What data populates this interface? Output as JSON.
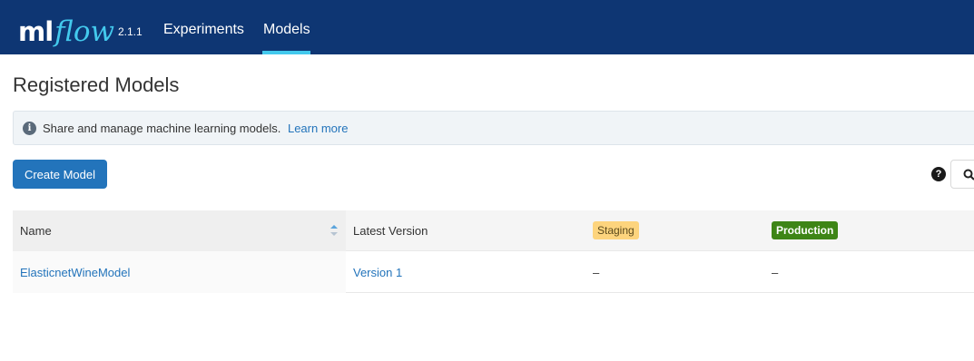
{
  "header": {
    "logo_ml": "ml",
    "logo_flow": "flow",
    "version": "2.1.1",
    "nav": [
      {
        "label": "Experiments"
      },
      {
        "label": "Models"
      }
    ],
    "active_tab": "Models",
    "colors": {
      "bar": "#0e3673",
      "accent": "#43c9ed"
    }
  },
  "page": {
    "title": "Registered Models",
    "info": {
      "icon": "info-icon",
      "text": "Share and manage machine learning models.",
      "link": "Learn more"
    },
    "create_button": "Create Model",
    "help_icon": "?",
    "search_icon": "search-icon"
  },
  "table": {
    "columns": {
      "name": "Name",
      "latest_version": "Latest Version",
      "staging": "Staging",
      "production": "Production"
    },
    "rows": [
      {
        "name": "ElasticnetWineModel",
        "latest_version": "Version 1",
        "staging": "–",
        "production": "–"
      }
    ],
    "tag_colors": {
      "staging": "#fdd47d",
      "production": "#3e8516"
    }
  }
}
